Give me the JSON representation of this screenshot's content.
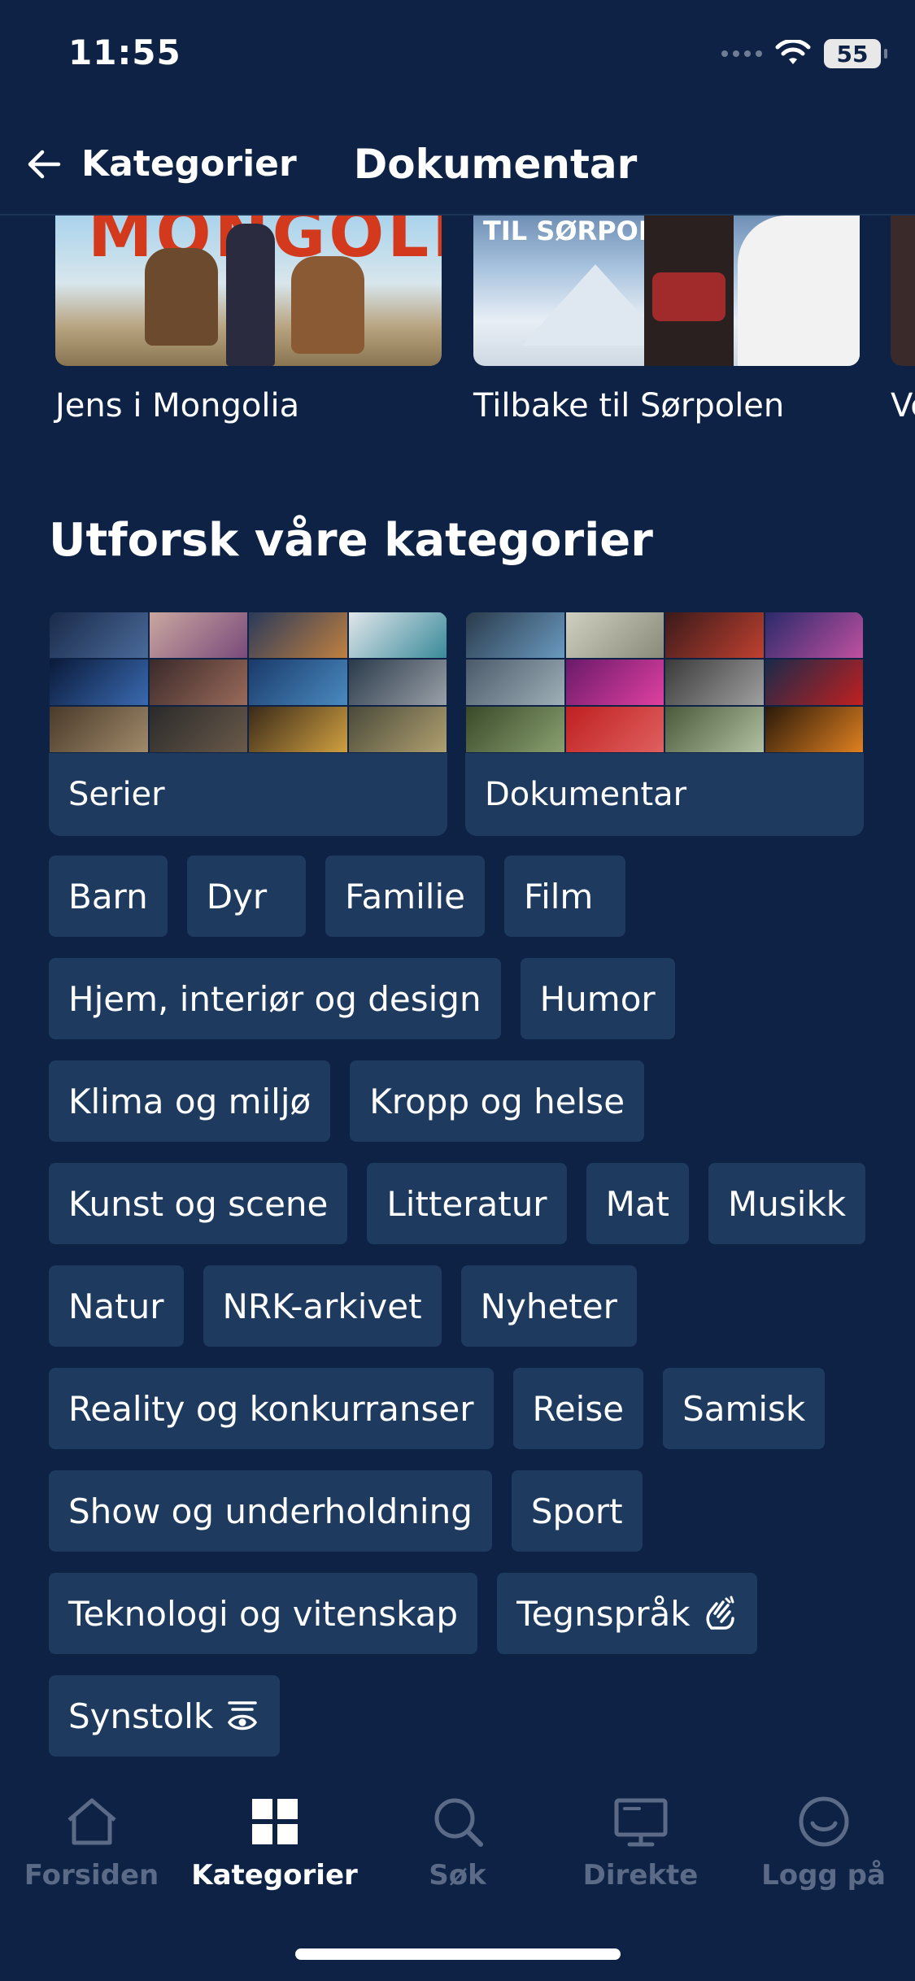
{
  "status": {
    "time": "11:55",
    "battery": "55"
  },
  "nav": {
    "back_label": "Kategorier",
    "title": "Dokumentar"
  },
  "carousel": [
    {
      "title": "Jens i Mongolia",
      "thumb_text": "MONGOLIA"
    },
    {
      "title": "Tilbake til Sørpolen",
      "thumb_text": "TIL SØRPOLEN"
    },
    {
      "title": "Ve"
    }
  ],
  "section_title": "Utforsk våre kategorier",
  "big_tiles": [
    {
      "label": "Serier"
    },
    {
      "label": "Dokumentar"
    }
  ],
  "chips": [
    {
      "label": "Barn"
    },
    {
      "label": "Dyr"
    },
    {
      "label": "Familie"
    },
    {
      "label": "Film"
    },
    {
      "label": "Hjem, interiør og design"
    },
    {
      "label": "Humor"
    },
    {
      "label": "Klima og miljø"
    },
    {
      "label": "Kropp og helse"
    },
    {
      "label": "Kunst og scene"
    },
    {
      "label": "Litteratur"
    },
    {
      "label": "Mat"
    },
    {
      "label": "Musikk"
    },
    {
      "label": "Natur"
    },
    {
      "label": "NRK-arkivet"
    },
    {
      "label": "Nyheter"
    },
    {
      "label": "Reality og konkurranser"
    },
    {
      "label": "Reise"
    },
    {
      "label": "Samisk"
    },
    {
      "label": "Show og underholdning"
    },
    {
      "label": "Sport"
    },
    {
      "label": "Teknologi og vitenskap"
    },
    {
      "label": "Tegnspråk",
      "icon": "sign-language-icon"
    },
    {
      "label": "Synstolk",
      "icon": "audio-description-icon"
    }
  ],
  "tabs": [
    {
      "label": "Forsiden",
      "icon": "home-icon"
    },
    {
      "label": "Kategorier",
      "icon": "grid-icon",
      "active": true
    },
    {
      "label": "Søk",
      "icon": "search-icon"
    },
    {
      "label": "Direkte",
      "icon": "tv-icon"
    },
    {
      "label": "Logg på",
      "icon": "profile-icon"
    }
  ],
  "colors": {
    "background": "#0d2244",
    "chip": "#1e3a5f",
    "inactive_tab": "#5b6b87"
  }
}
